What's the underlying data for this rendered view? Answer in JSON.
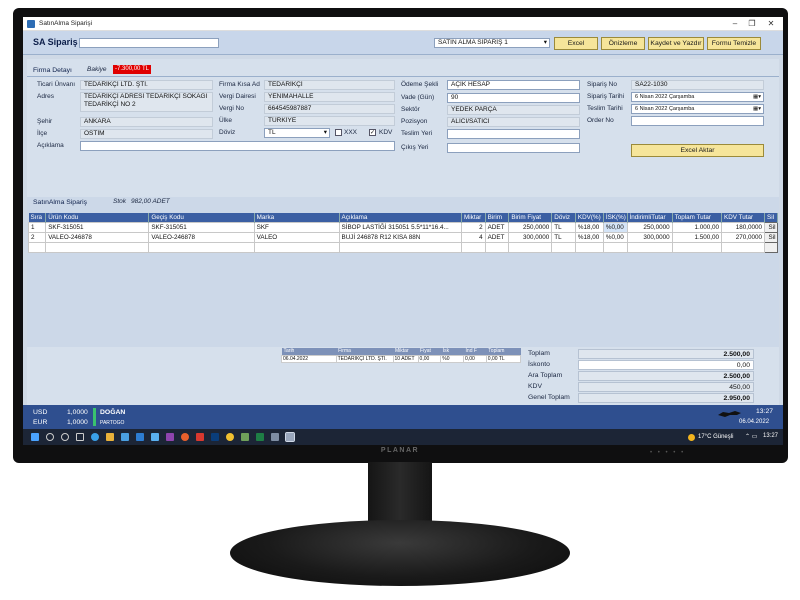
{
  "monitor": {
    "brand": "PLANAR"
  },
  "window": {
    "title": "SatınAlma Siparişi",
    "controls": [
      "–",
      "❐",
      "✕"
    ]
  },
  "header": {
    "title": "SA Sipariş",
    "search_value": "",
    "form_select": "SATIN ALMA SİPARİŞ 1",
    "buttons": {
      "excel": "Excel",
      "preview": "Önizleme",
      "save_print": "Kaydet ve Yazdır",
      "clear": "Formu Temizle"
    }
  },
  "firm_section": {
    "title": "Firma Detayı",
    "balance_label": "Bakiye",
    "balance_value": "-7.300,00 TL",
    "fields": {
      "trade_name_label": "Ticari Ünvanı",
      "trade_name": "TEDARİKÇİ LTD. ŞTİ.",
      "address_label": "Adres",
      "address": "TEDARİKÇİ ADRESİ  TEDARİKÇİ SOKAĞI TEDARİKÇİ NO 2",
      "city_label": "Şehir",
      "city": "ANKARA",
      "district_label": "İlçe",
      "district": "OSTİM",
      "note_label": "Açıklama",
      "note": "",
      "short_name_label": "Firma Kısa Ad",
      "short_name": "TEDARİKÇİ",
      "tax_office_label": "Vergi Dairesi",
      "tax_office": "YENİMAHALLE",
      "tax_no_label": "Vergi No",
      "tax_no": "664545987887",
      "country_label": "Ülke",
      "country": "TÜRKİYE",
      "currency_label": "Döviz",
      "currency": "TL",
      "xxx_label": "XXX",
      "xxx_checked": false,
      "kdv_label": "KDV",
      "kdv_checked": true,
      "payment_label": "Ödeme Şekli",
      "payment": "AÇIK HESAP",
      "term_label": "Vade (Gün)",
      "term": "90",
      "sector_label": "Sektör",
      "sector": "YEDEK PARÇA",
      "position_label": "Pozisyon",
      "position": "ALICI/SATICI",
      "delivery_place_label": "Teslim Yeri",
      "delivery_place": "",
      "exit_place_label": "Çıkış Yeri",
      "exit_place": "",
      "order_no_label": "Sipariş No",
      "order_no": "SA22-1030",
      "order_date_label": "Sipariş Tarihi",
      "order_date": "6   Nisan   2022 Çarşamba",
      "delivery_date_label": "Teslim Tarihi",
      "delivery_date": "6   Nisan   2022 Çarşamba",
      "order_ref_label": "Order No",
      "order_ref": "",
      "excel_transfer": "Excel Aktar"
    }
  },
  "order_section": {
    "title": "SatınAlma Sipariş",
    "stock_label": "Stok",
    "stock_value": "982,00 ADET",
    "columns": [
      "Sıra",
      "Ürün Kodu",
      "Geçiş Kodu",
      "Marka",
      "Açıklama",
      "Miktar",
      "Birim",
      "Birim Fiyat",
      "Döviz",
      "KDV(%)",
      "İSK(%)",
      "İndirimliTutar",
      "Toplam Tutar",
      "KDV Tutar",
      "Sil"
    ],
    "rows": [
      [
        "1",
        "SKF-315051",
        "SKF-315051",
        "SKF",
        "SİBOP LASTİĞİ 315051 5.5*11*16.4...",
        "2",
        "ADET",
        "250,0000",
        "TL",
        "%18,00",
        "%0,00",
        "250,0000",
        "1.000,00",
        "180,0000",
        "Sil"
      ],
      [
        "2",
        "VALEO-246878",
        "VALEO-246878",
        "VALEO",
        "BUJİ 246878 R12 KISA 88N",
        "4",
        "ADET",
        "300,0000",
        "TL",
        "%18,00",
        "%0,00",
        "300,0000",
        "1.500,00",
        "270,0000",
        "Sil"
      ]
    ]
  },
  "stock_history": {
    "columns": [
      "Tarih",
      "Firma",
      "Miktar",
      "Fiyat",
      "İsk",
      "İnd F",
      "Toplam"
    ],
    "rows": [
      [
        "06.04.2022",
        "TEDARİKÇİ LTD. ŞTİ.",
        "10  ADET",
        "0,00",
        "%0",
        "0,00",
        "0,00  TL"
      ]
    ]
  },
  "totals": {
    "total_label": "Toplam",
    "total": "2.500,00",
    "discount_label": "İskonto",
    "discount": "0,00",
    "subtotal_label": "Ara Toplam",
    "subtotal": "2.500,00",
    "kdv_label": "KDV",
    "kdv": "450,00",
    "grand_label": "Genel Toplam",
    "grand": "2.950,00"
  },
  "bottom": {
    "usd_label": "USD",
    "usd": "1,0000",
    "eur_label": "EUR",
    "eur": "1,0000",
    "user": "DOĞAN",
    "company": "PARTOGO",
    "time": "13:27",
    "date": "06.04.2022"
  },
  "taskbar": {
    "weather": "17°C  Güneşli",
    "clock": "13:27"
  },
  "colors": {
    "accent": "#3b5fa3",
    "button": "#f6e59a",
    "balance": "#e00000",
    "bar": "#2f4f8f"
  }
}
